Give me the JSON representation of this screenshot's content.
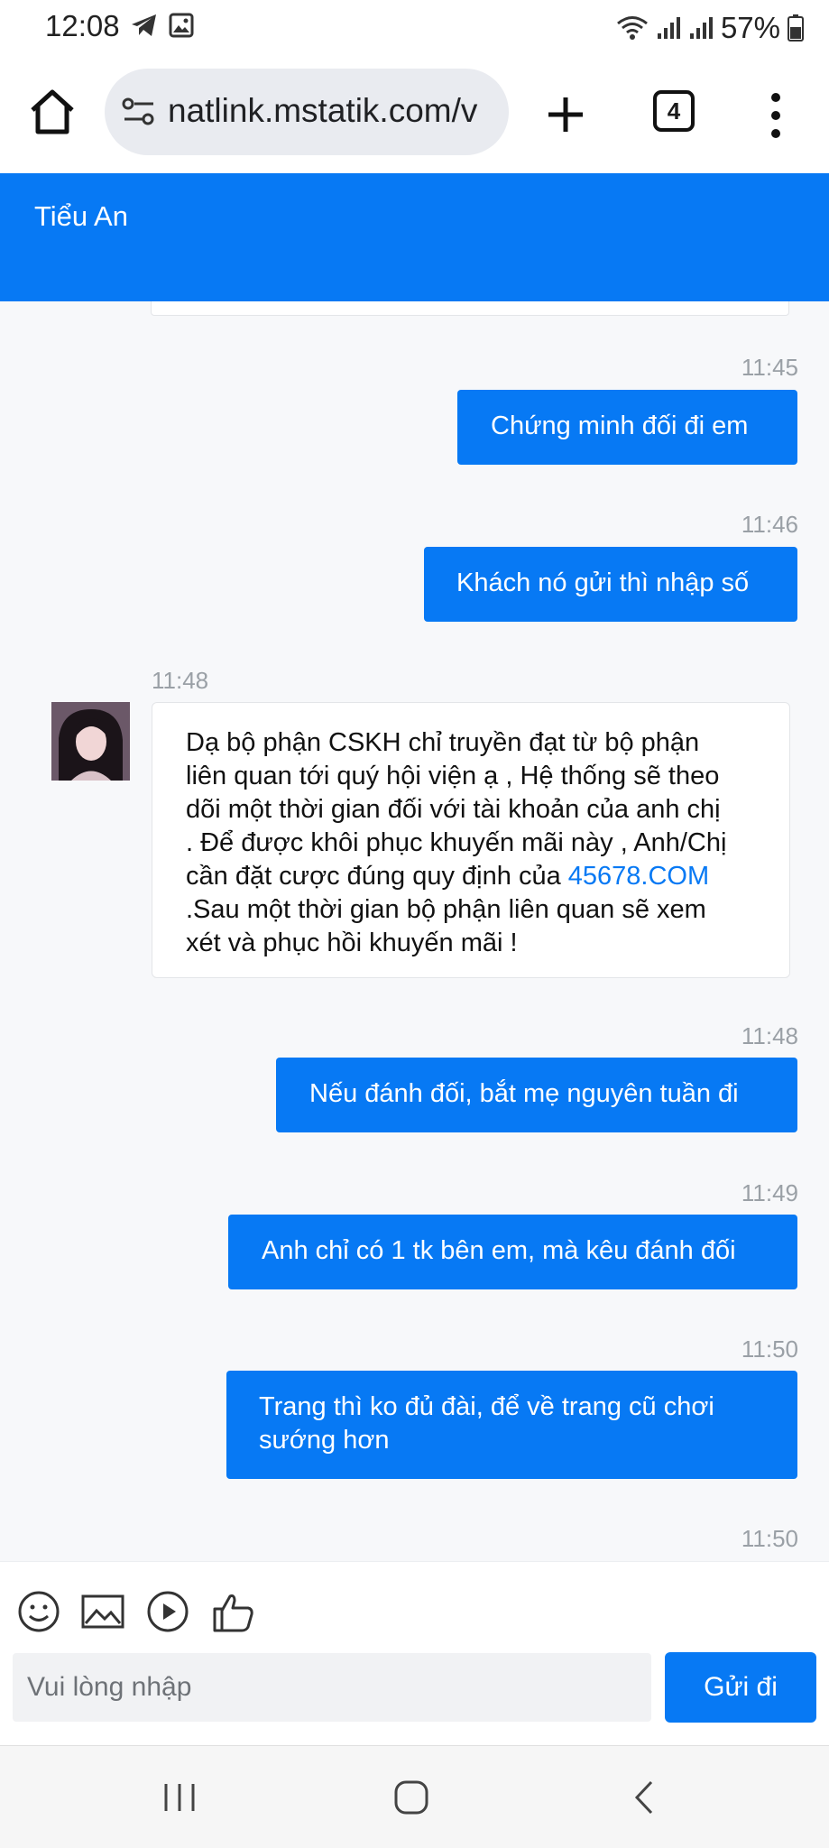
{
  "status_bar": {
    "time": "12:08",
    "battery": "57%",
    "icons": [
      "telegram-icon",
      "gallery-icon",
      "wifi-icon",
      "signal-icon",
      "signal-icon",
      "battery-icon"
    ]
  },
  "browser": {
    "url": "natlink.mstatik.com/v",
    "tab_count": "4"
  },
  "chat": {
    "title": "Tiểu An",
    "accent_color": "#0779f4",
    "messages": [
      {
        "dir": "out",
        "time": "11:45",
        "text": "Chứng minh đối đi em"
      },
      {
        "dir": "out",
        "time": "11:46",
        "text": "Khách nó gửi thì nhập số"
      },
      {
        "dir": "in",
        "time": "11:48",
        "lines": [
          "Dạ bộ phận CSKH chỉ truyền đạt từ bộ phận",
          "liên quan tới quý hội viện ạ , Hệ thống sẽ theo",
          "dõi một thời gian đối với tài khoản của anh chị",
          ". Để được khôi phục khuyến mãi này , Anh/Chị"
        ],
        "link_line_prefix": "cần đặt cược đúng quy định của ",
        "link_text": "45678.COM",
        "tail_lines": [
          ".Sau một thời gian bộ phận liên quan sẽ xem",
          "xét và phục hồi khuyến mãi !"
        ]
      },
      {
        "dir": "out",
        "time": "11:48",
        "text": "Nếu đánh đối, bắt mẹ nguyên tuần đi"
      },
      {
        "dir": "out",
        "time": "11:49",
        "text": "Anh chỉ có 1 tk bên em, mà kêu đánh đối"
      },
      {
        "dir": "out",
        "time": "11:50",
        "lines": [
          "Trang thì ko đủ đài, để về trang cũ chơi",
          "sướng hơn"
        ]
      },
      {
        "dir": "out",
        "time": "11:50"
      }
    ]
  },
  "composer": {
    "tools": [
      "emoji-icon",
      "image-icon",
      "video-icon",
      "like-icon"
    ],
    "placeholder": "Vui lòng nhập",
    "send_label": "Gửi đi"
  },
  "nav": [
    "recent-apps-icon",
    "home-icon",
    "back-icon"
  ]
}
